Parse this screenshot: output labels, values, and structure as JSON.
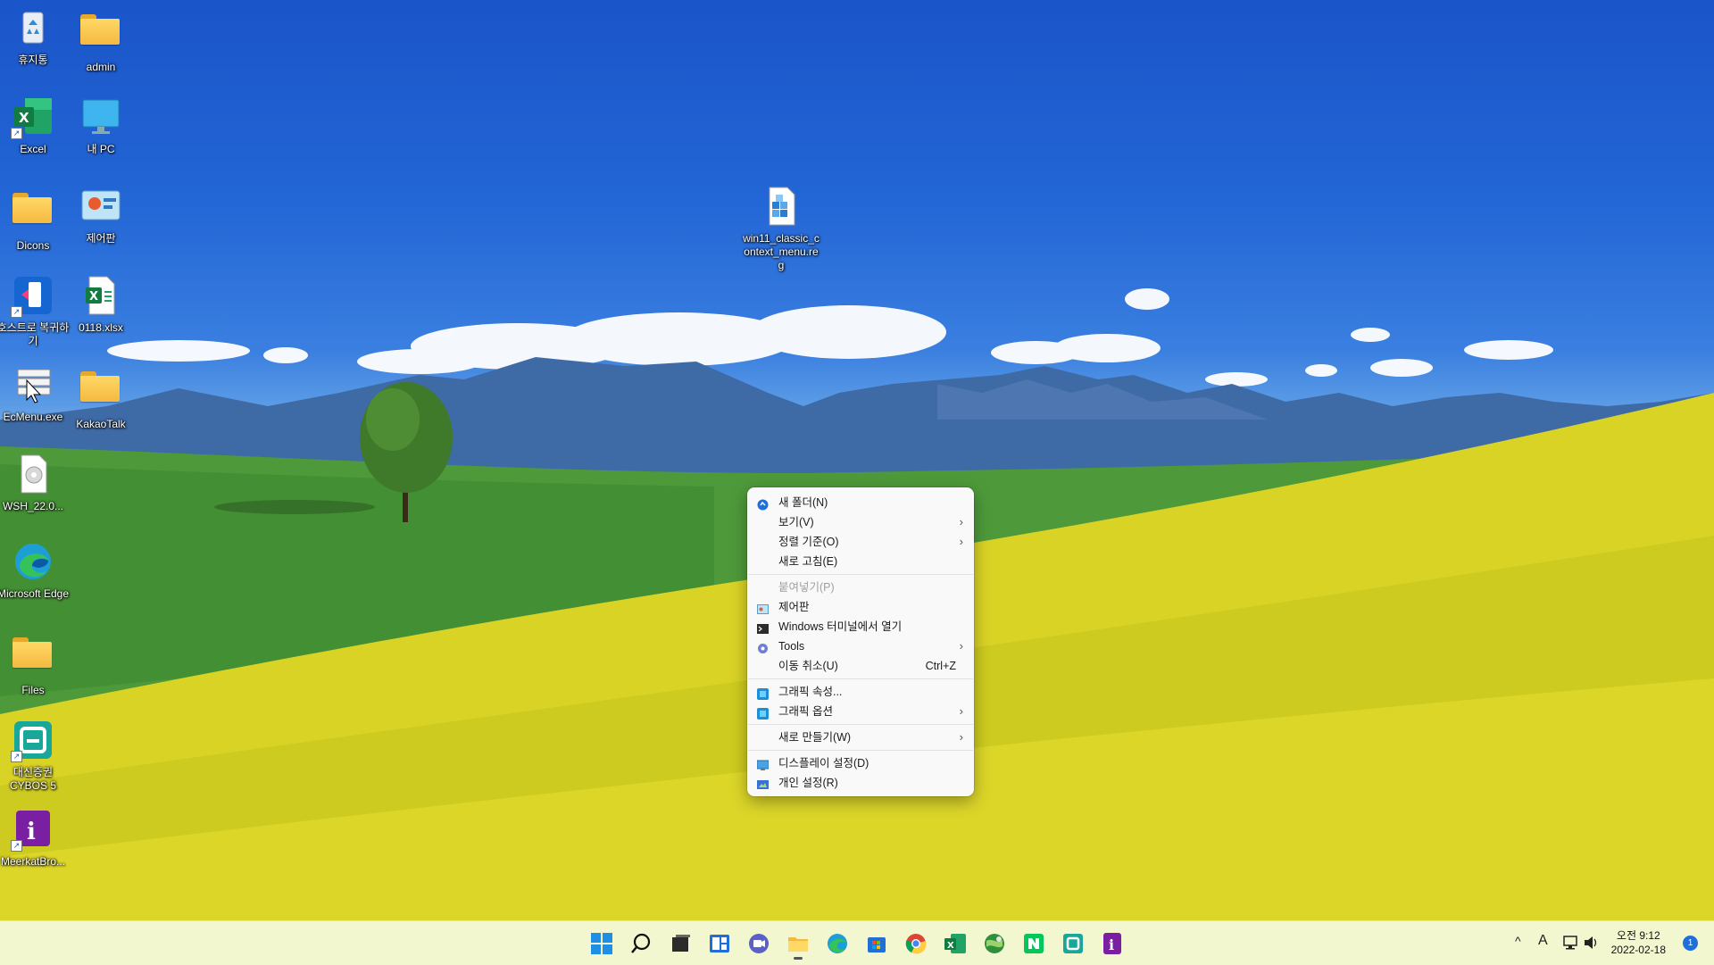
{
  "desktop": {
    "icons": [
      {
        "label": "휴지통"
      },
      {
        "label": "admin"
      },
      {
        "label": "Excel"
      },
      {
        "label": "내 PC"
      },
      {
        "label": "Dicons"
      },
      {
        "label": "제어판"
      },
      {
        "label": "호스트로 복귀하기"
      },
      {
        "label": "0118.xlsx"
      },
      {
        "label": "EcMenu.exe"
      },
      {
        "label": "KakaoTalk"
      },
      {
        "label": "WSH_22.0..."
      },
      {
        "label": "Microsoft Edge"
      },
      {
        "label": "Files"
      },
      {
        "label": "대신증권 CYBOS 5"
      },
      {
        "label": "MeerkatBro..."
      },
      {
        "label": "win11_classic_context_menu.reg"
      }
    ]
  },
  "context_menu": {
    "items": [
      {
        "label": "새 폴더(N)",
        "icon": "new-folder-icon"
      },
      {
        "label": "보기(V)",
        "has_submenu": true
      },
      {
        "label": "정렬 기준(O)",
        "has_submenu": true
      },
      {
        "label": "새로 고침(E)"
      },
      {
        "label": "붙여넣기(P)",
        "disabled": true
      },
      {
        "label": "제어판",
        "icon": "control-panel-icon"
      },
      {
        "label": "Windows 터미널에서 열기",
        "icon": "terminal-icon"
      },
      {
        "label": "Tools",
        "icon": "tools-icon",
        "has_submenu": true
      },
      {
        "label": "이동 취소(U)",
        "shortcut": "Ctrl+Z"
      },
      {
        "label": "그래픽 속성...",
        "icon": "graphics-icon"
      },
      {
        "label": "그래픽 옵션",
        "icon": "graphics-icon",
        "has_submenu": true
      },
      {
        "label": "새로 만들기(W)",
        "has_submenu": true
      },
      {
        "label": "디스플레이 설정(D)",
        "icon": "display-icon"
      },
      {
        "label": "개인 설정(R)",
        "icon": "personalize-icon"
      }
    ]
  },
  "taskbar": {
    "apps": [
      "start-icon",
      "search-icon",
      "task-view-icon",
      "widgets-icon",
      "chat-icon",
      "file-explorer-icon",
      "edge-icon",
      "store-icon",
      "chrome-icon",
      "excel-icon",
      "network-globe-icon",
      "naver-icon",
      "cybos-icon",
      "meerkat-icon"
    ],
    "tray": {
      "chevron": "^",
      "ime": "A",
      "time": "오전 9:12",
      "date": "2022-02-18",
      "notifications": "1"
    }
  },
  "colors": {
    "menu_bg": "#f9f9f9",
    "taskbar_bg": "#f3f7cd",
    "accent": "#1e6fd9"
  }
}
